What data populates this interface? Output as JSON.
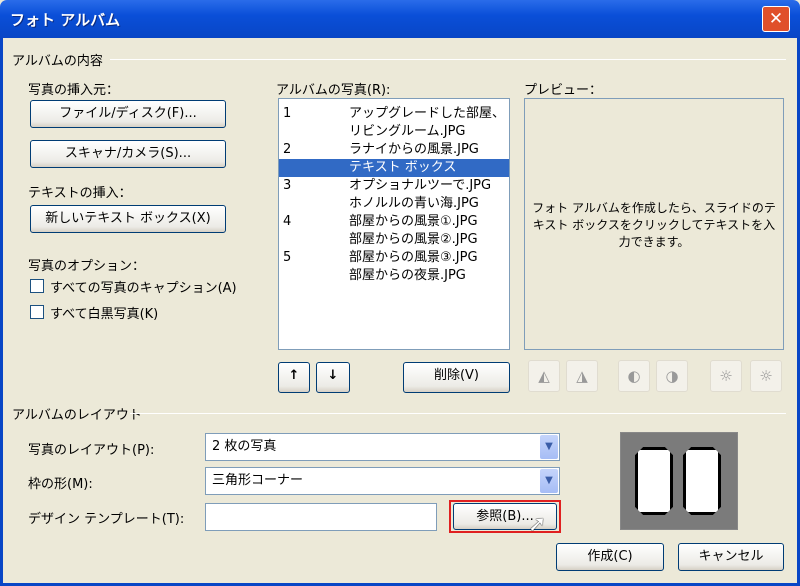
{
  "window": {
    "title": "フォト アルバム",
    "close": "✕"
  },
  "content_group": {
    "title": "アルバムの内容",
    "insert_from_label": "写真の挿入元：",
    "file_button": "ファイル/ディスク(F)...",
    "scanner_button": "スキャナ/カメラ(S)...",
    "insert_text_label": "テキストの挿入：",
    "new_textbox_button": "新しいテキスト ボックス(X)",
    "options_label": "写真のオプション：",
    "caption_checkbox": "すべての写真のキャプション(A)",
    "bw_checkbox": "すべて白黒写真(K)",
    "album_photos_label": "アルバムの写真(R):",
    "photos": [
      {
        "num": "1",
        "name": "アップグレードした部屋、"
      },
      {
        "num": "",
        "name": "リビングルーム.JPG"
      },
      {
        "num": "2",
        "name": "ラナイからの風景.JPG"
      },
      {
        "num": "",
        "name": "テキスト ボックス",
        "selected": true
      },
      {
        "num": "3",
        "name": "オプショナルツーで.JPG"
      },
      {
        "num": "",
        "name": "ホノルルの青い海.JPG"
      },
      {
        "num": "4",
        "name": "部屋からの風景①.JPG"
      },
      {
        "num": "",
        "name": "部屋からの風景②.JPG"
      },
      {
        "num": "5",
        "name": "部屋からの風景③.JPG"
      },
      {
        "num": "",
        "name": "部屋からの夜景.JPG"
      }
    ],
    "move_up": "↑",
    "move_down": "↓",
    "delete_button": "削除(V)",
    "preview_label": "プレビュー：",
    "preview_text": "フォト アルバムを作成したら、スライドのテキスト ボックスをクリックしてテキストを入力できます。"
  },
  "layout_group": {
    "title": "アルバムのレイアウト",
    "picture_layout_label": "写真のレイアウト(P):",
    "picture_layout_value": "2 枚の写真",
    "frame_shape_label": "枠の形(M):",
    "frame_shape_value": "三角形コーナー",
    "design_template_label": "デザイン テンプレート(T):",
    "design_template_value": "",
    "browse_button": "参照(B)..."
  },
  "footer": {
    "create_button": "作成(C)",
    "cancel_button": "キャンセル"
  },
  "colors": {
    "highlight": "#316ac5",
    "browse_border": "#e02020"
  }
}
